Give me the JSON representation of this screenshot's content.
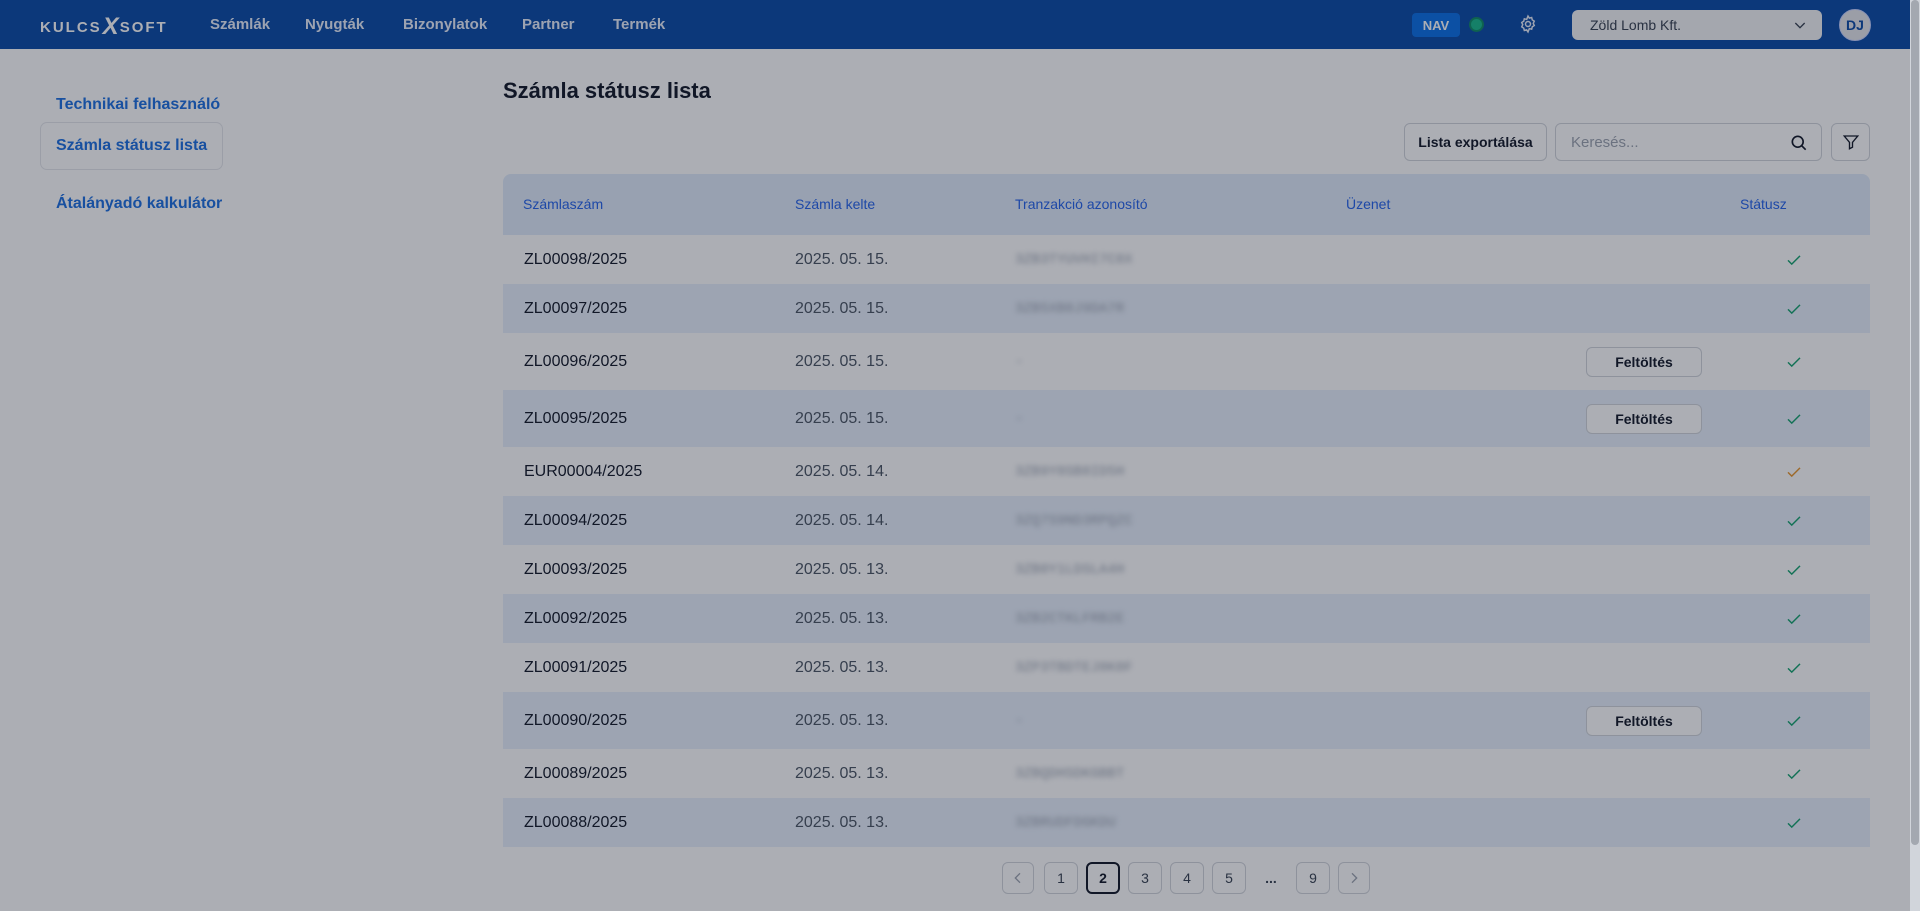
{
  "nav": {
    "logo": "KULCS X SOFT",
    "logo_left": "KULCS",
    "logo_x": "X",
    "logo_right": "SOFT",
    "items": [
      "Számlák",
      "Nyugták",
      "Bizonylatok",
      "Partner",
      "Termék"
    ],
    "nav_badge": "NAV",
    "company": "Zöld Lomb Kft.",
    "avatar": "DJ"
  },
  "sidebar": {
    "items": [
      "Technikai felhasználó",
      "Számla státusz lista",
      "Átalányadó kalkulátor"
    ],
    "active_index": 1
  },
  "page": {
    "title": "Számla státusz lista",
    "export_label": "Lista exportálása",
    "search_placeholder": "Keresés..."
  },
  "table": {
    "headers": [
      "Számlaszám",
      "Számla kelte",
      "Tranzakció azonosító",
      "Üzenet",
      "Státusz"
    ],
    "upload_label": "Feltöltés",
    "rows": [
      {
        "invoice": "ZL00098/2025",
        "date": "2025. 05. 15.",
        "tx": "3ZB3TYUVHI7C8X",
        "upload": false,
        "status": "ok"
      },
      {
        "invoice": "ZL00097/2025",
        "date": "2025. 05. 15.",
        "tx": "3ZB5XB0J9DA7R",
        "upload": false,
        "status": "ok"
      },
      {
        "invoice": "ZL00096/2025",
        "date": "2025. 05. 15.",
        "tx": "-",
        "upload": true,
        "status": "ok"
      },
      {
        "invoice": "ZL00095/2025",
        "date": "2025. 05. 15.",
        "tx": "-",
        "upload": true,
        "status": "ok"
      },
      {
        "invoice": "EUR00004/2025",
        "date": "2025. 05. 14.",
        "tx": "3ZB9Y0SB8ID5H",
        "upload": false,
        "status": "warning"
      },
      {
        "invoice": "ZL00094/2025",
        "date": "2025. 05. 14.",
        "tx": "3ZQ7S9ND3RPQZC",
        "upload": false,
        "status": "ok"
      },
      {
        "invoice": "ZL00093/2025",
        "date": "2025. 05. 13.",
        "tx": "3ZB0Y1LDSLA4H",
        "upload": false,
        "status": "ok"
      },
      {
        "invoice": "ZL00092/2025",
        "date": "2025. 05. 13.",
        "tx": "3ZB2CTKLFRB2E",
        "upload": false,
        "status": "ok"
      },
      {
        "invoice": "ZL00091/2025",
        "date": "2025. 05. 13.",
        "tx": "3ZP3TBDTEJ8K0F",
        "upload": false,
        "status": "ok"
      },
      {
        "invoice": "ZL00090/2025",
        "date": "2025. 05. 13.",
        "tx": "-",
        "upload": true,
        "status": "ok"
      },
      {
        "invoice": "ZL00089/2025",
        "date": "2025. 05. 13.",
        "tx": "3ZBQDHSDKGBBT",
        "upload": false,
        "status": "ok"
      },
      {
        "invoice": "ZL00088/2025",
        "date": "2025. 05. 13.",
        "tx": "3ZBRUDFDGKDU",
        "upload": false,
        "status": "ok"
      }
    ]
  },
  "pagination": {
    "pages": [
      "1",
      "2",
      "3",
      "4",
      "5",
      "...",
      "9"
    ],
    "current": "2"
  },
  "colors": {
    "nav_bg": "#0a4aa6",
    "accent": "#1d6fe0",
    "status_ok": "#14a36f",
    "status_warning": "#e8962c"
  }
}
